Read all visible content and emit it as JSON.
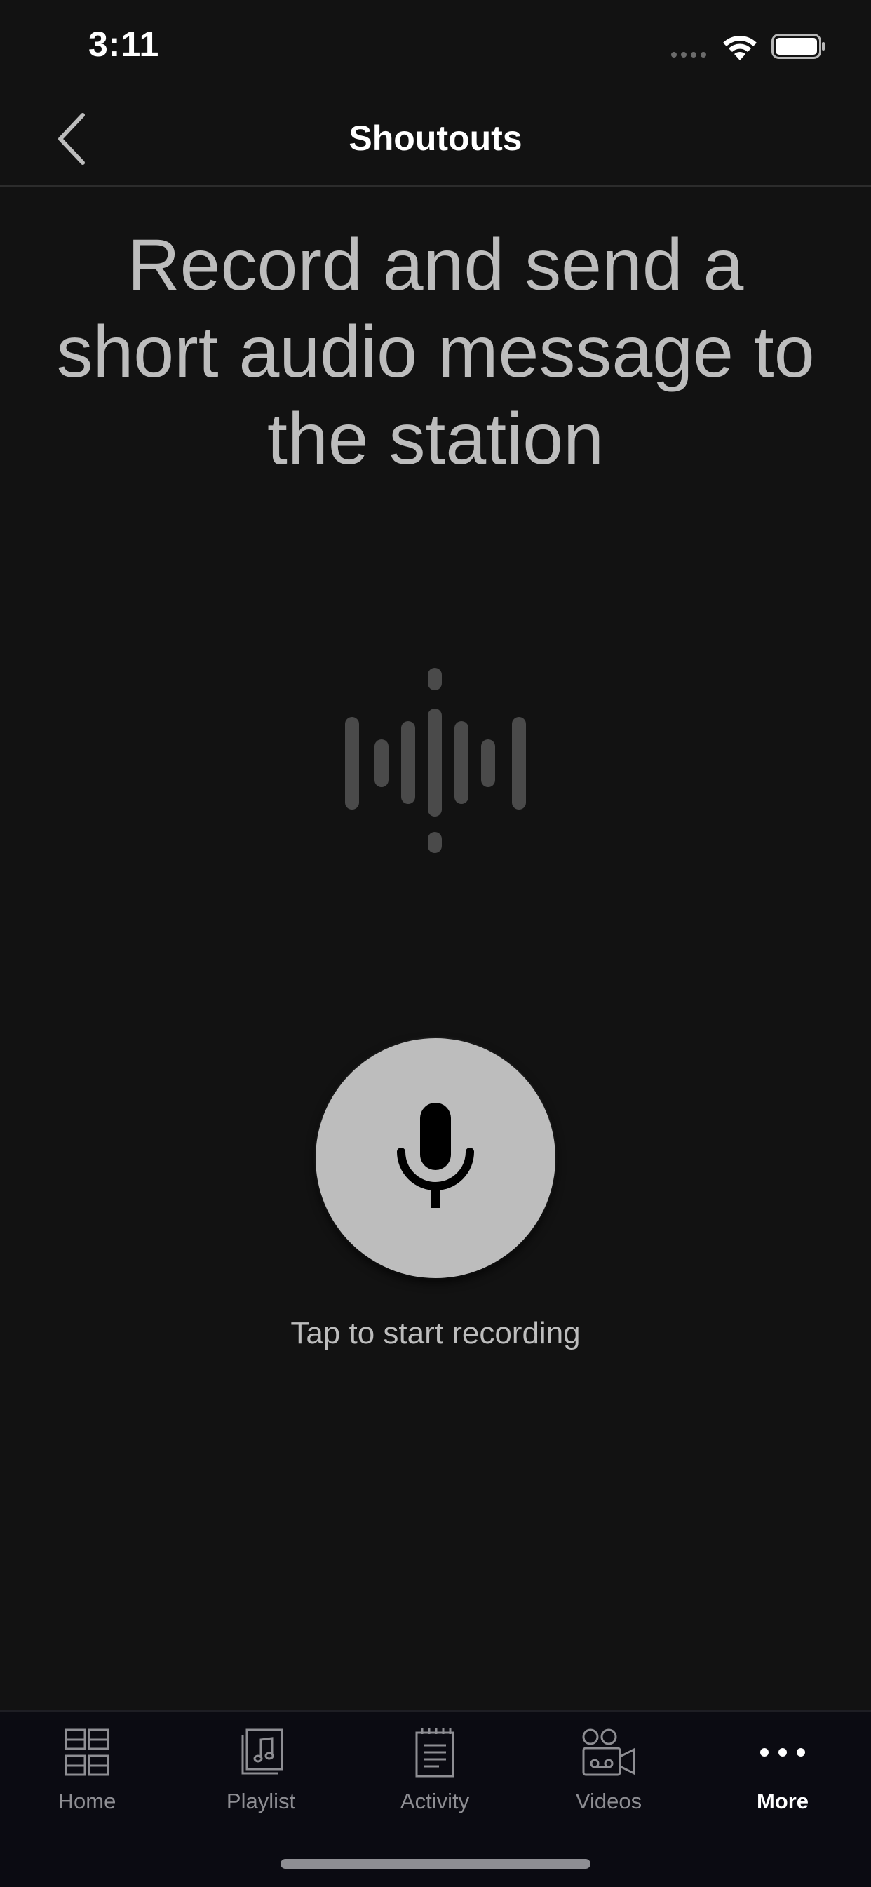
{
  "status_bar": {
    "time": "3:11"
  },
  "nav": {
    "title": "Shoutouts"
  },
  "main": {
    "heading": "Record and send a short audio message to the station",
    "record_hint": "Tap to start recording"
  },
  "tabs": [
    {
      "label": "Home",
      "icon": "grid-icon",
      "active": false
    },
    {
      "label": "Playlist",
      "icon": "music-note-icon",
      "active": false
    },
    {
      "label": "Activity",
      "icon": "notepad-icon",
      "active": false
    },
    {
      "label": "Videos",
      "icon": "video-camera-icon",
      "active": false
    },
    {
      "label": "More",
      "icon": "more-dots-icon",
      "active": true
    }
  ],
  "colors": {
    "background": "#121212",
    "tab_bar_background": "#0b0b12",
    "text_muted": "#bdbdbd",
    "tab_inactive": "#8e8e93",
    "tab_active": "#ffffff",
    "record_button": "#bdbdbd"
  }
}
